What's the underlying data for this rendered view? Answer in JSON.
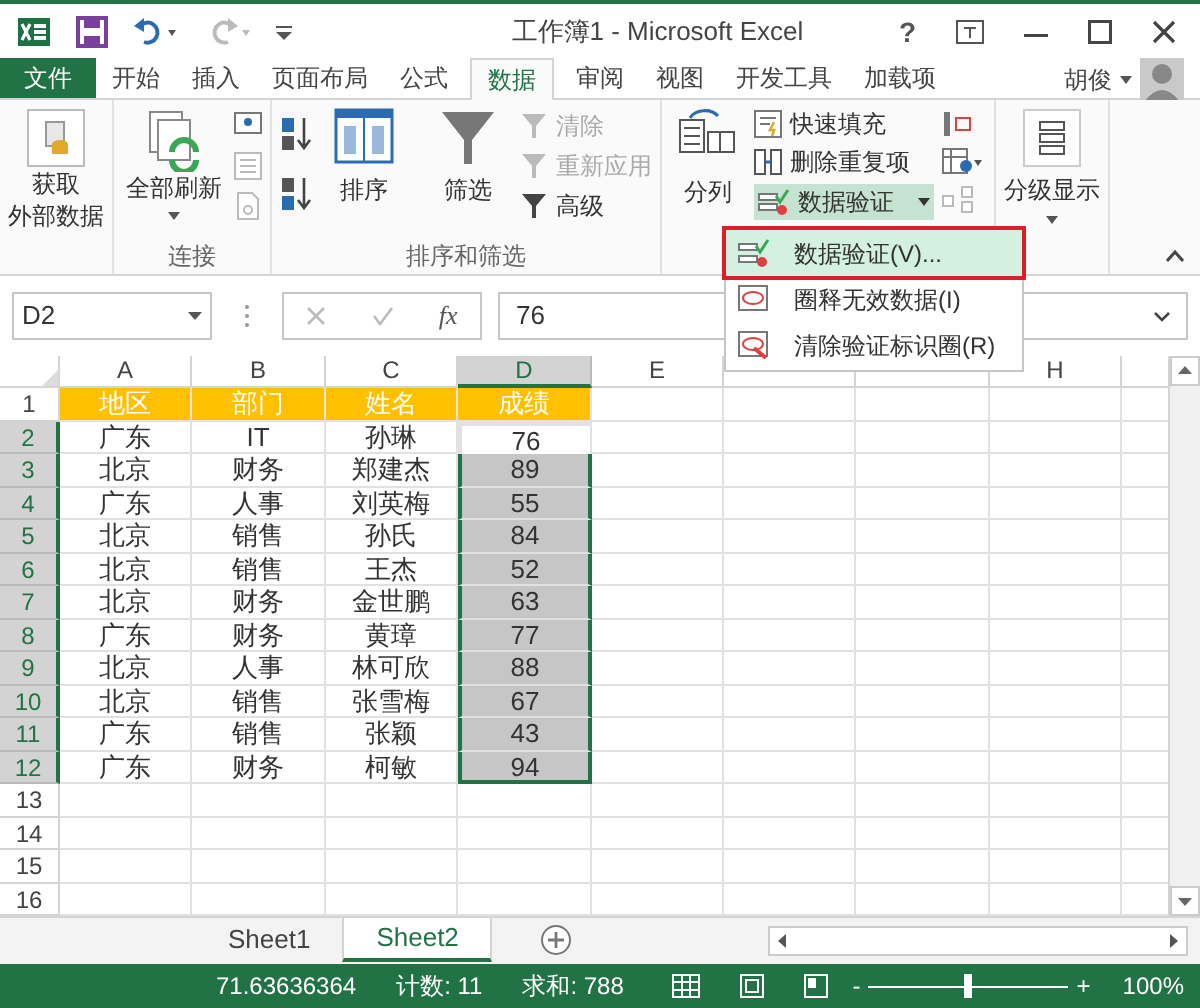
{
  "window": {
    "title": "工作簿1 - Microsoft Excel",
    "help_label": "?"
  },
  "ribbon_tabs": [
    {
      "label": "文件",
      "kind": "file",
      "selected": false
    },
    {
      "label": "开始",
      "kind": "tab",
      "selected": false
    },
    {
      "label": "插入",
      "kind": "tab",
      "selected": false
    },
    {
      "label": "页面布局",
      "kind": "tab",
      "selected": false
    },
    {
      "label": "公式",
      "kind": "tab",
      "selected": false
    },
    {
      "label": "数据",
      "kind": "tab",
      "selected": true
    },
    {
      "label": "审阅",
      "kind": "tab",
      "selected": false
    },
    {
      "label": "视图",
      "kind": "tab",
      "selected": false
    },
    {
      "label": "开发工具",
      "kind": "tab",
      "selected": false
    },
    {
      "label": "加载项",
      "kind": "tab",
      "selected": false
    }
  ],
  "user": {
    "name": "胡俊"
  },
  "ribbon": {
    "get_external": {
      "lines": [
        "获取",
        "外部数据"
      ]
    },
    "connections": {
      "refresh_label": "全部刷新",
      "group_label": "连接"
    },
    "sort_filter": {
      "sort_label": "排序",
      "filter_label": "筛选",
      "group_label": "排序和筛选",
      "commands": [
        {
          "label": "清除",
          "disabled": true
        },
        {
          "label": "重新应用",
          "disabled": true
        },
        {
          "label": "高级",
          "disabled": false
        }
      ]
    },
    "data_tools": {
      "split_label": "分列",
      "flash_fill": "快速填充",
      "remove_duplicates": "删除重复项",
      "validation": {
        "label": "数据验证",
        "expanded": true
      }
    },
    "outline": {
      "label": "分级显示"
    }
  },
  "dropdown_menu": {
    "items": [
      {
        "label": "数据验证(V)...",
        "selected": true
      },
      {
        "label": "圈释无效数据(I)",
        "selected": false
      },
      {
        "label": "清除验证标识圈(R)",
        "selected": false
      }
    ]
  },
  "formula_bar": {
    "name_box": "D2",
    "function_label": "fx",
    "formula": "76"
  },
  "sheet": {
    "columns": [
      {
        "label": "A",
        "selected": false
      },
      {
        "label": "B",
        "selected": false
      },
      {
        "label": "C",
        "selected": false
      },
      {
        "label": "D",
        "selected": true
      },
      {
        "label": "E",
        "selected": false
      },
      {
        "selected": false
      },
      {
        "selected": false
      },
      {
        "label": "H",
        "selected": false
      }
    ],
    "rows": [
      {
        "number": "1",
        "kind": "header",
        "selected": false,
        "cells": [
          "地区",
          "部门",
          "姓名",
          "成绩"
        ]
      },
      {
        "number": "2",
        "kind": "data",
        "selected": true,
        "score_highlighted": false,
        "cells": [
          "广东",
          "IT",
          "孙琳",
          "76"
        ]
      },
      {
        "number": "3",
        "kind": "data",
        "selected": true,
        "score_highlighted": true,
        "cells": [
          "北京",
          "财务",
          "郑建杰",
          "89"
        ]
      },
      {
        "number": "4",
        "kind": "data",
        "selected": true,
        "score_highlighted": true,
        "cells": [
          "广东",
          "人事",
          "刘英梅",
          "55"
        ]
      },
      {
        "number": "5",
        "kind": "data",
        "selected": true,
        "score_highlighted": true,
        "cells": [
          "北京",
          "销售",
          "孙氏",
          "84"
        ]
      },
      {
        "number": "6",
        "kind": "data",
        "selected": true,
        "score_highlighted": true,
        "cells": [
          "北京",
          "销售",
          "王杰",
          "52"
        ]
      },
      {
        "number": "7",
        "kind": "data",
        "selected": true,
        "score_highlighted": true,
        "cells": [
          "北京",
          "财务",
          "金世鹏",
          "63"
        ]
      },
      {
        "number": "8",
        "kind": "data",
        "selected": true,
        "score_highlighted": true,
        "cells": [
          "广东",
          "财务",
          "黄璋",
          "77"
        ]
      },
      {
        "number": "9",
        "kind": "data",
        "selected": true,
        "score_highlighted": true,
        "cells": [
          "北京",
          "人事",
          "林可欣",
          "88"
        ]
      },
      {
        "number": "10",
        "kind": "data",
        "selected": true,
        "score_highlighted": true,
        "cells": [
          "北京",
          "销售",
          "张雪梅",
          "67"
        ]
      },
      {
        "number": "11",
        "kind": "data",
        "selected": true,
        "score_highlighted": true,
        "cells": [
          "广东",
          "销售",
          "张颖",
          "43"
        ]
      },
      {
        "number": "12",
        "kind": "data",
        "selected": true,
        "score_highlighted": true,
        "cells": [
          "广东",
          "财务",
          "柯敏",
          "94"
        ]
      },
      {
        "number": "13",
        "kind": "empty",
        "selected": false
      },
      {
        "number": "14",
        "kind": "empty",
        "selected": false
      },
      {
        "number": "15",
        "kind": "empty",
        "selected": false
      },
      {
        "number": "16",
        "kind": "empty",
        "selected": false
      }
    ]
  },
  "sheet_tabs": [
    {
      "label": "Sheet1",
      "selected": false
    },
    {
      "label": "Sheet2",
      "selected": true
    }
  ],
  "status_bar": {
    "average": "71.63636364",
    "count": "计数: 11",
    "sum": "求和: 788",
    "zoom_out": "-",
    "zoom_in": "+",
    "zoom": "100%",
    "zoom_slider": {
      "level": 0.5
    }
  }
}
